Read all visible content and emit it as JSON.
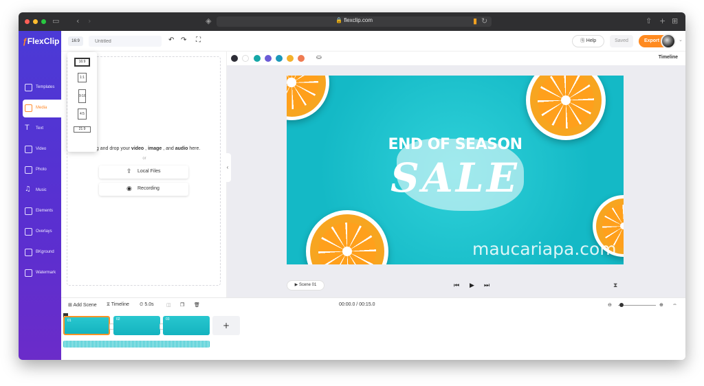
{
  "browser": {
    "url": "flexclip.com",
    "traffic_lights": [
      "#ff5f57",
      "#febc2e",
      "#28c840"
    ]
  },
  "sidebar": {
    "logo": "FlexClip",
    "items": [
      {
        "label": "Templates",
        "icon": "templates-icon"
      },
      {
        "label": "Media",
        "icon": "media-icon",
        "active": true
      },
      {
        "label": "Text",
        "icon": "text-icon"
      },
      {
        "label": "Video",
        "icon": "video-icon"
      },
      {
        "label": "Photo",
        "icon": "photo-icon"
      },
      {
        "label": "Music",
        "icon": "music-icon"
      },
      {
        "label": "Elements",
        "icon": "elements-icon"
      },
      {
        "label": "Overlays",
        "icon": "overlays-icon"
      },
      {
        "label": "BKground",
        "icon": "background-icon"
      },
      {
        "label": "Watermark",
        "icon": "watermark-icon"
      }
    ]
  },
  "toolbar": {
    "ratio": "16:9",
    "title_placeholder": "Untitled",
    "help": "Help",
    "saved": "Saved",
    "export": "Export →"
  },
  "ratio_popup": {
    "options": [
      "16:9",
      "1:1",
      "9:16",
      "4:5",
      "21:9"
    ],
    "selected": "16:9"
  },
  "media_panel": {
    "drop_prefix": "Drag and drop your ",
    "drop_video": "video",
    "drop_sep1": " , ",
    "drop_image": "image",
    "drop_sep2": " , and ",
    "drop_audio": "audio",
    "drop_suffix": " here.",
    "or": "or",
    "local_files": "Local Files",
    "recording": "Recording"
  },
  "canvas": {
    "colors": [
      "#2d2d36",
      "#ffffff",
      "#16a7a7",
      "#6b5bd6",
      "#1b98b9",
      "#f4b22b",
      "#ef7b52"
    ],
    "timeline_label": "Timeline",
    "headline_top": "END OF SEASON",
    "headline_sale": "SALE",
    "watermark": "maucariapa.com",
    "scene_label": "▶ Scene 01"
  },
  "timeline": {
    "add_scene": "Add Scene",
    "timeline": "Timeline",
    "duration": "5.0s",
    "time": "00:00.0 / 00:15.0",
    "zoom_level": 0.05,
    "clips": [
      {
        "num": "01"
      },
      {
        "num": "02"
      },
      {
        "num": "03"
      }
    ],
    "add": "+"
  }
}
